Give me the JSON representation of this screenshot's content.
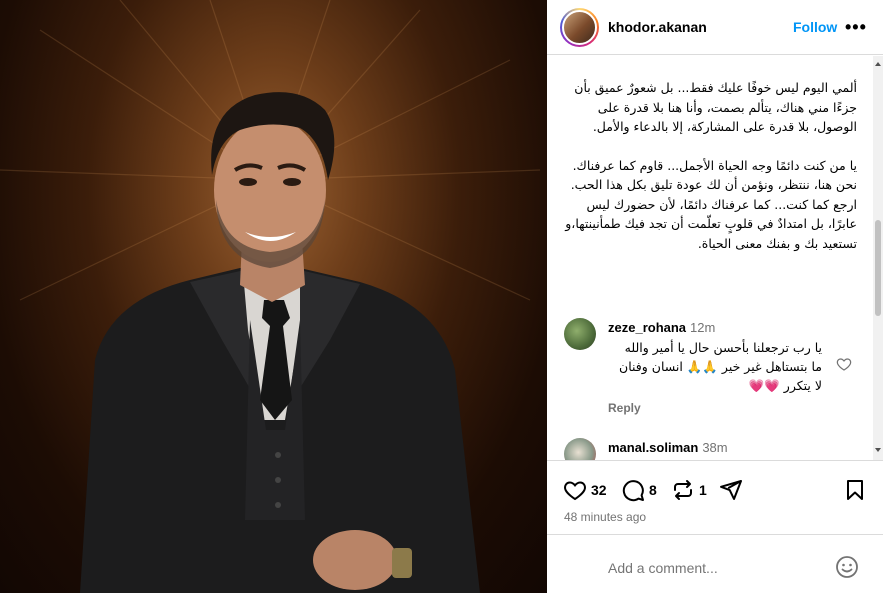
{
  "post": {
    "username": "khodor.akanan",
    "follow_label": "Follow",
    "more_label": "•••",
    "caption": [
      "ألمي اليوم ليس خوفًا عليك فقط... بل شعورٌ عميق بأن جزءًا مني هناك، يتألم بصمت، وأنا هنا بلا قدرة على الوصول، بلا قدرة على المشاركة، إلا بالدعاء والأمل.",
      "",
      "يا من كنت دائمًا وجه الحياة الأجمل... قاوم كما عرفناك. نحن هنا، ننتظر، ونؤمن أن لك عودة تليق بكل هذا الحب.",
      "ارجع كما كنت... كما عرفناك دائمًا، لأن حضورك ليس عابرًا، بل امتدادٌ في قلوبٍ تعلّمت أن تجد فيك طمأنينتها،و تستعيد بك و بفنك معنى الحياة."
    ],
    "likes": "32",
    "comments_count": "8",
    "reposts": "1",
    "time_ago": "48 minutes ago",
    "add_comment_placeholder": "Add a comment..."
  },
  "comments": [
    {
      "username": "zeze_rohana",
      "time": "12m",
      "text": "يا رب ترجعلنا بأحسن حال يا أمير والله ما بتستاهل غير خير 🙏🙏 انسان وفنان لا يتكرر 💗💗",
      "reply_label": "Reply"
    },
    {
      "username": "manal.soliman",
      "time": "38m",
      "text": ""
    }
  ],
  "icons": {
    "like": "heart-icon",
    "comment": "comment-icon",
    "repost": "repost-icon",
    "share": "share-icon",
    "save": "bookmark-icon",
    "emoji": "emoji-icon",
    "more": "more-icon"
  },
  "colors": {
    "follow": "#0095f6",
    "secondary_text": "#737373",
    "border": "#dbdbdb"
  }
}
